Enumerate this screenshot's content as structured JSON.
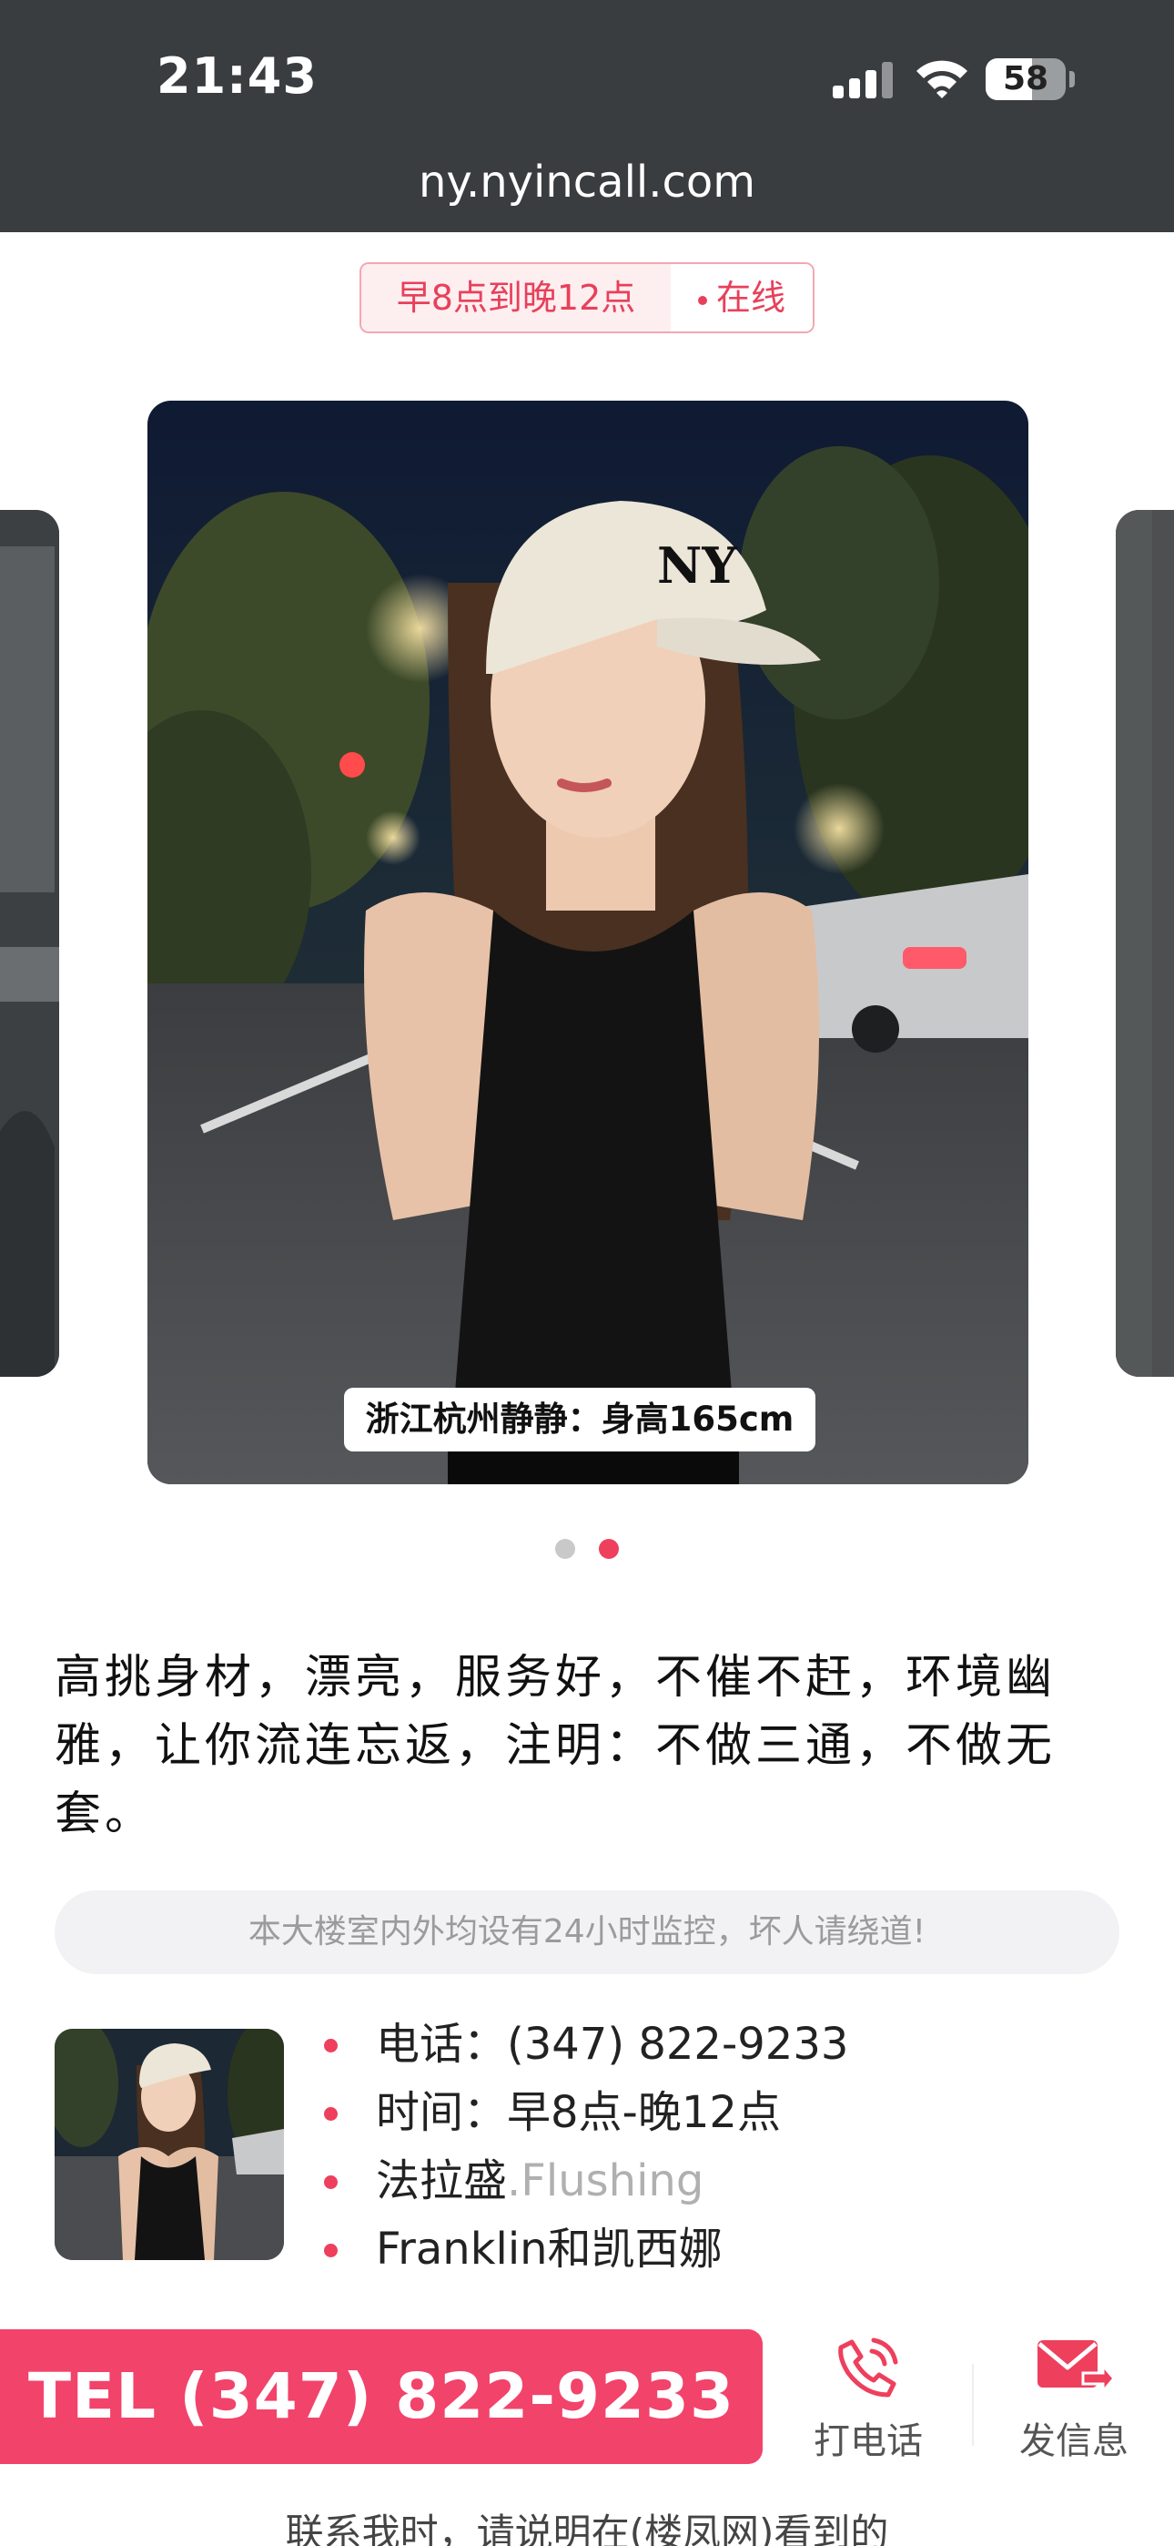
{
  "status_bar": {
    "time": "21:43",
    "battery_level": "58",
    "battery_fraction": 0.58,
    "icons": [
      "cellular-signal-icon",
      "wifi-icon",
      "battery-icon"
    ]
  },
  "browser": {
    "url": "ny.nyincall.com"
  },
  "hours_badge": {
    "hours": "早8点到晚12点",
    "status": "在线"
  },
  "carousel": {
    "caption": "浙江杭州静静：身高165cm",
    "slide_count": 2,
    "active_index": 1
  },
  "description": "高挑身材，漂亮，服务好，不催不赶，环境幽雅，让你流连忘返，注明：不做三通，不做无套。",
  "notice": "本大楼室内外均设有24小时监控，坏人请绕道!",
  "contact": {
    "phone": "电话：(347) 822-9233",
    "hours": "时间：早8点-晚12点",
    "location_cn": "法拉盛",
    "location_en": ".Flushing",
    "street": "Franklin和凯西娜"
  },
  "actions": {
    "tel_button": "TEL (347) 822-9233",
    "call_label": "打电话",
    "message_label": "发信息"
  },
  "footer_note": "联系我时，请说明在(楼凤网)看到的",
  "colors": {
    "accent": "#ee3f5d",
    "tel_button": "#f2436b",
    "topbar": "#3a3d40"
  }
}
